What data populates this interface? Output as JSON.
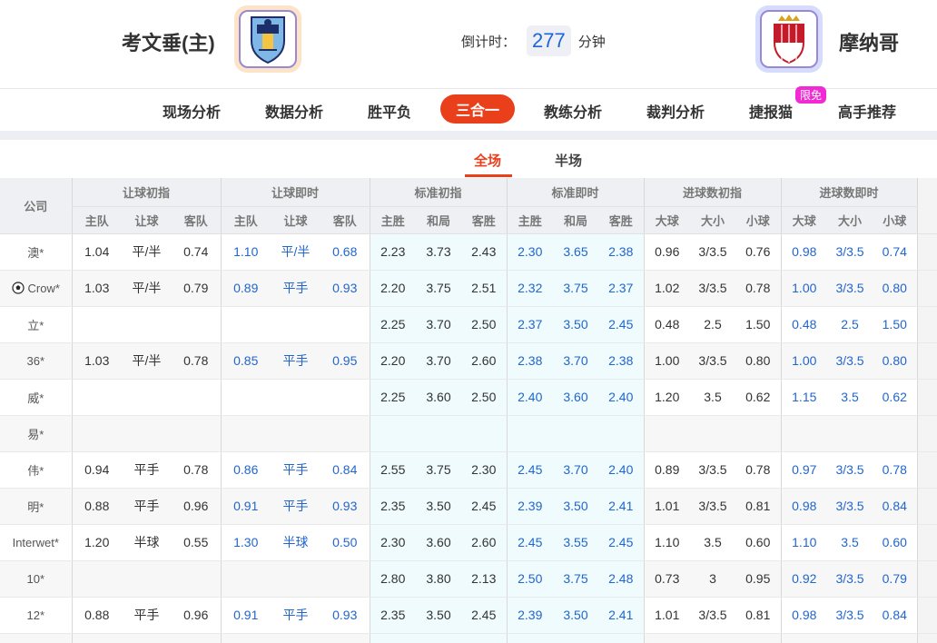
{
  "header": {
    "home_name": "考文垂(主)",
    "away_name": "摩纳哥",
    "countdown_label": "倒计时：",
    "countdown_value": "277",
    "countdown_unit": "分钟"
  },
  "nav": {
    "items": [
      "现场分析",
      "数据分析",
      "胜平负",
      "三合一",
      "教练分析",
      "裁判分析",
      "捷报猫",
      "高手推荐"
    ],
    "active": "三合一",
    "badge": "限免"
  },
  "scope": {
    "full": "全场",
    "half": "半场"
  },
  "table": {
    "company_header": "公司",
    "groups": [
      "让球初指",
      "让球即时",
      "标准初指",
      "标准即时",
      "进球数初指",
      "进球数即时"
    ],
    "subheaders": [
      "主队",
      "让球",
      "客队",
      "主队",
      "让球",
      "客队",
      "主胜",
      "和局",
      "客胜",
      "主胜",
      "和局",
      "客胜",
      "大球",
      "大小",
      "小球",
      "大球",
      "大小",
      "小球"
    ],
    "rows": [
      {
        "company": "澳*",
        "cells": [
          "1.04",
          "平/半",
          "0.74",
          "1.10",
          "平/半",
          "0.68",
          "2.23",
          "3.73",
          "2.43",
          "2.30",
          "3.65",
          "2.38",
          "0.96",
          "3/3.5",
          "0.76",
          "0.98",
          "3/3.5",
          "0.74"
        ]
      },
      {
        "company": "Crow*",
        "ball": true,
        "cells": [
          "1.03",
          "平/半",
          "0.79",
          "0.89",
          "平手",
          "0.93",
          "2.20",
          "3.75",
          "2.51",
          "2.32",
          "3.75",
          "2.37",
          "1.02",
          "3/3.5",
          "0.78",
          "1.00",
          "3/3.5",
          "0.80"
        ]
      },
      {
        "company": "立*",
        "cells": [
          "",
          "",
          "",
          "",
          "",
          "",
          "2.25",
          "3.70",
          "2.50",
          "2.37",
          "3.50",
          "2.45",
          "0.48",
          "2.5",
          "1.50",
          "0.48",
          "2.5",
          "1.50"
        ]
      },
      {
        "company": "36*",
        "cells": [
          "1.03",
          "平/半",
          "0.78",
          "0.85",
          "平手",
          "0.95",
          "2.20",
          "3.70",
          "2.60",
          "2.38",
          "3.70",
          "2.38",
          "1.00",
          "3/3.5",
          "0.80",
          "1.00",
          "3/3.5",
          "0.80"
        ]
      },
      {
        "company": "威*",
        "cells": [
          "",
          "",
          "",
          "",
          "",
          "",
          "2.25",
          "3.60",
          "2.50",
          "2.40",
          "3.60",
          "2.40",
          "1.20",
          "3.5",
          "0.62",
          "1.15",
          "3.5",
          "0.62"
        ]
      },
      {
        "company": "易*",
        "cells": [
          "",
          "",
          "",
          "",
          "",
          "",
          "",
          "",
          "",
          "",
          "",
          "",
          "",
          "",
          "",
          "",
          "",
          ""
        ]
      },
      {
        "company": "伟*",
        "cells": [
          "0.94",
          "平手",
          "0.78",
          "0.86",
          "平手",
          "0.84",
          "2.55",
          "3.75",
          "2.30",
          "2.45",
          "3.70",
          "2.40",
          "0.89",
          "3/3.5",
          "0.78",
          "0.97",
          "3/3.5",
          "0.78"
        ]
      },
      {
        "company": "明*",
        "cells": [
          "0.88",
          "平手",
          "0.96",
          "0.91",
          "平手",
          "0.93",
          "2.35",
          "3.50",
          "2.45",
          "2.39",
          "3.50",
          "2.41",
          "1.01",
          "3/3.5",
          "0.81",
          "0.98",
          "3/3.5",
          "0.84"
        ]
      },
      {
        "company": "Interwet*",
        "cells": [
          "1.20",
          "半球",
          "0.55",
          "1.30",
          "半球",
          "0.50",
          "2.30",
          "3.60",
          "2.60",
          "2.45",
          "3.55",
          "2.45",
          "1.10",
          "3.5",
          "0.60",
          "1.10",
          "3.5",
          "0.60"
        ]
      },
      {
        "company": "10*",
        "cells": [
          "",
          "",
          "",
          "",
          "",
          "",
          "2.80",
          "3.80",
          "2.13",
          "2.50",
          "3.75",
          "2.48",
          "0.73",
          "3",
          "0.95",
          "0.92",
          "3/3.5",
          "0.79"
        ]
      },
      {
        "company": "12*",
        "cells": [
          "0.88",
          "平手",
          "0.96",
          "0.91",
          "平手",
          "0.93",
          "2.35",
          "3.50",
          "2.45",
          "2.39",
          "3.50",
          "2.41",
          "1.01",
          "3/3.5",
          "0.81",
          "0.98",
          "3/3.5",
          "0.84"
        ]
      },
      {
        "company": "",
        "cells": [
          "",
          "",
          "",
          "",
          "",
          "",
          "",
          "",
          "",
          "",
          "",
          "",
          "",
          "",
          "",
          "",
          "",
          ""
        ]
      }
    ]
  },
  "colors": {
    "accent": "#ea3f1b",
    "live_odds": "#2266cc",
    "badge": "#f02bd4",
    "countdown": "#1a66d8"
  }
}
